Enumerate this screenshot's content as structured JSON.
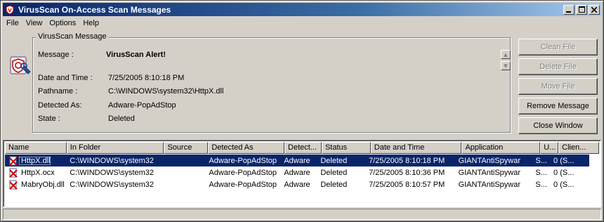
{
  "window": {
    "title": "VirusScan On-Access Scan Messages",
    "controls": {
      "minimize": "_",
      "maximize": "□",
      "close": "×"
    }
  },
  "menu": [
    "File",
    "View",
    "Options",
    "Help"
  ],
  "message_group": {
    "legend": "VirusScan Message",
    "icon": "virusscan-shield-icon",
    "fields": {
      "message_label": "Message :",
      "message_value": "VirusScan Alert!",
      "datetime_label": "Date and Time :",
      "datetime_value": "7/25/2005 8:10:18 PM",
      "pathname_label": "Pathname :",
      "pathname_value": "C:\\WINDOWS\\system32\\HttpX.dll",
      "detected_label": "Detected As:",
      "detected_value": "Adware-PopAdStop",
      "state_label": "State :",
      "state_value": "Deleted"
    }
  },
  "actions": {
    "clean_file": "Clean File",
    "delete_file": "Delete File",
    "move_file": "Move File",
    "remove_message": "Remove Message",
    "close_window": "Close Window"
  },
  "list": {
    "columns": [
      "Name",
      "In Folder",
      "Source",
      "Detected As",
      "Detect...",
      "Status",
      "Date and Time",
      "Application",
      "U...",
      "Clien..."
    ],
    "rows": [
      [
        "HttpX.dll",
        "C:\\WINDOWS\\system32",
        "",
        "Adware-PopAdStop",
        "Adware",
        "Deleted",
        "7/25/2005 8:10:18 PM",
        "GIANTAntiSpywar",
        "S...",
        "0 (S..."
      ],
      [
        "HttpX.ocx",
        "C:\\WINDOWS\\system32",
        "",
        "Adware-PopAdStop",
        "Adware",
        "Deleted",
        "7/25/2005 8:10:36 PM",
        "GIANTAntiSpywar",
        "S...",
        "0 (S..."
      ],
      [
        "MabryObj.dll",
        "C:\\WINDOWS\\system32",
        "",
        "Adware-PopAdStop",
        "Adware",
        "Deleted",
        "7/25/2005 8:10:57 PM",
        "GIANTAntiSpywar",
        "S...",
        "0 (S..."
      ]
    ],
    "selected_row": 0
  },
  "colors": {
    "selection": "#0a246a",
    "titlebar": "#0a246a",
    "face": "#d4d0c8"
  }
}
